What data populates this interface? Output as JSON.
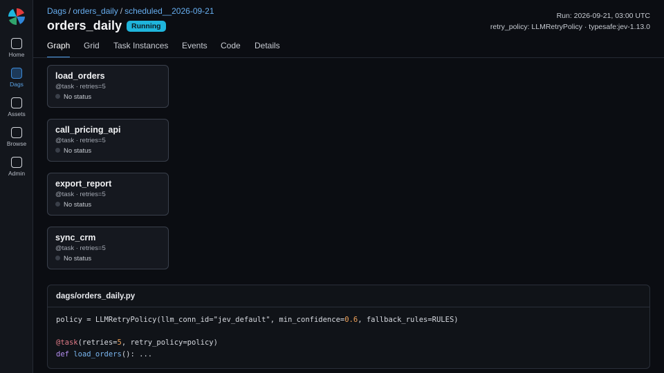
{
  "sidebar": {
    "items": [
      {
        "label": "Home"
      },
      {
        "label": "Dags"
      },
      {
        "label": "Assets"
      },
      {
        "label": "Browse"
      },
      {
        "label": "Admin"
      }
    ],
    "active": "Dags"
  },
  "breadcrumb": [
    "Dags",
    "orders_daily",
    "scheduled__2026-09-21"
  ],
  "header": {
    "title": "orders_daily",
    "state": "Running",
    "run": "Run: 2026-09-21, 03:00 UTC",
    "policy_line": "retry_policy: LLMRetryPolicy · typesafe:jev-1.13.0"
  },
  "tabs": [
    {
      "label": "Graph"
    },
    {
      "label": "Grid"
    },
    {
      "label": "Task Instances"
    },
    {
      "label": "Events"
    },
    {
      "label": "Code"
    },
    {
      "label": "Details"
    }
  ],
  "active_tab": "Graph",
  "tasks": [
    {
      "name": "load_orders",
      "meta": "@task · retries=5",
      "status": "No status"
    },
    {
      "name": "call_pricing_api",
      "meta": "@task · retries=5",
      "status": "No status"
    },
    {
      "name": "export_report",
      "meta": "@task · retries=5",
      "status": "No status"
    },
    {
      "name": "sync_crm",
      "meta": "@task · retries=5",
      "status": "No status"
    }
  ],
  "code": {
    "filename": "dags/orders_daily.py",
    "line1_pre": "policy = LLMRetryPolicy(llm_conn_id=\"jev_default\", min_confidence=",
    "line1_num": "0.6",
    "line1_post": ", fallback_rules=RULES)",
    "line3_dec": "@task",
    "line3_a": "(retries=",
    "line3_num": "5",
    "line3_b": ", retry_policy=policy)",
    "line4_kw": "def",
    "line4_fn": "load_orders",
    "line4_rest": "(): ..."
  },
  "colors": {
    "accent": "#4b9ae6",
    "running_badge": "#1fb5dc",
    "background": "#0b0d12"
  }
}
